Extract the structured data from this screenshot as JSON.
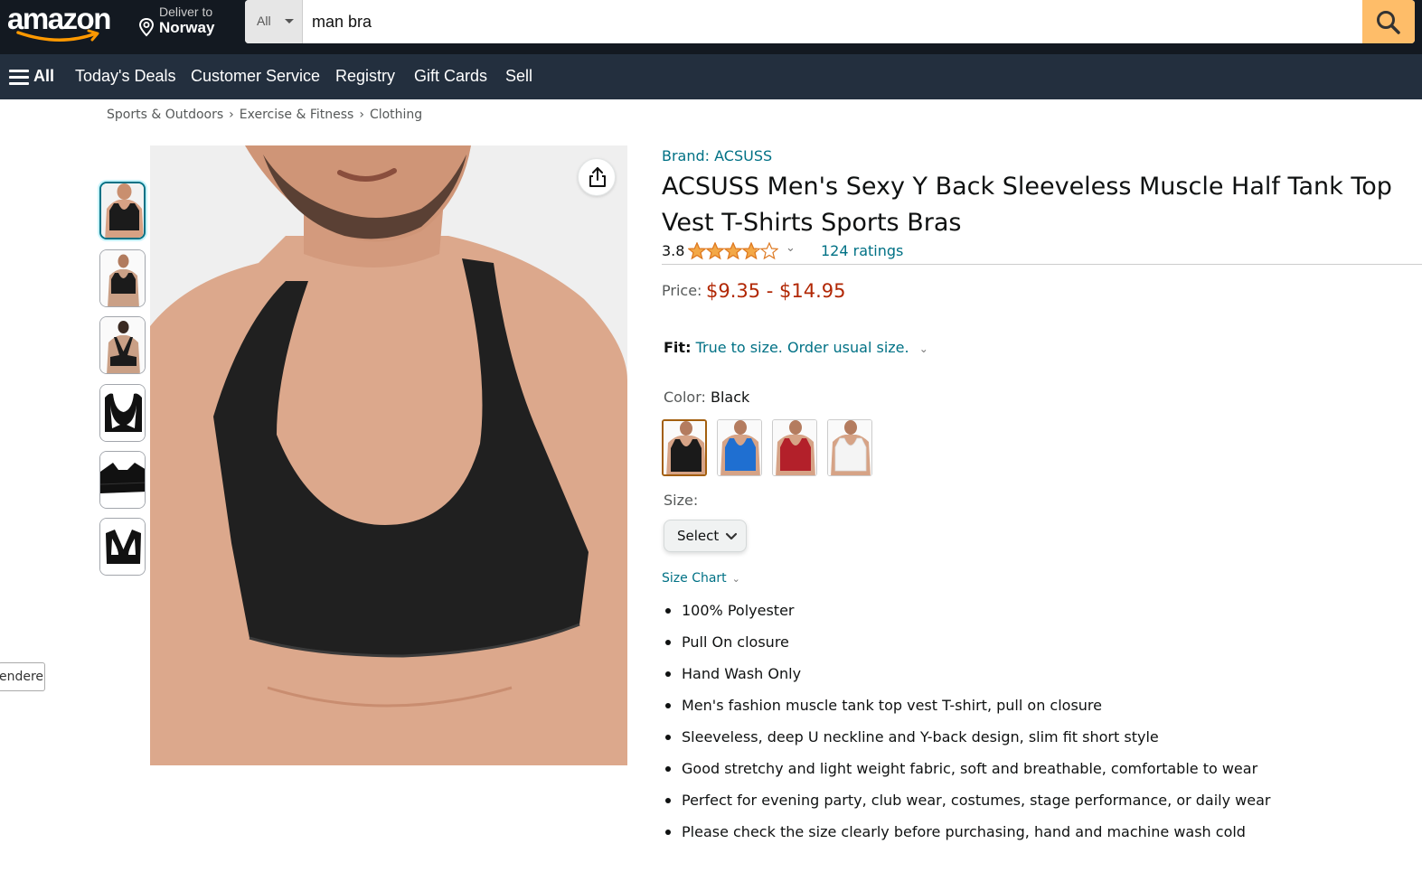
{
  "header": {
    "logo_text": "amazon",
    "deliver_to_label": "Deliver to",
    "deliver_to_location": "Norway",
    "search": {
      "category": "All",
      "query": "man bra"
    }
  },
  "nav": {
    "all_label": "All",
    "items": [
      "Today's Deals",
      "Customer Service",
      "Registry",
      "Gift Cards",
      "Sell"
    ]
  },
  "breadcrumb": [
    "Sports & Outdoors",
    "Exercise & Fitness",
    "Clothing"
  ],
  "breadcrumb_separator": "›",
  "side_tooltip": "endere",
  "product": {
    "brand": "Brand: ACSUSS",
    "title": "ACSUSS Men's Sexy Y Back Sleeveless Muscle Half Tank Top Vest T-Shirts Sports Bras",
    "rating_value": "3.8",
    "rating_stars": 3.8,
    "ratings_count": "124 ratings",
    "price_label": "Price:",
    "price_value": "$9.35 - $14.95",
    "fit_label": "Fit:",
    "fit_value": "True to size. Order usual size.",
    "color_label": "Color:",
    "color_value": "Black",
    "swatches": [
      {
        "name": "black",
        "color": "#1a1a1a"
      },
      {
        "name": "blue",
        "color": "#1f6fd1"
      },
      {
        "name": "red",
        "color": "#b3202a"
      },
      {
        "name": "white",
        "color": "#f4f4f4"
      }
    ],
    "size_label": "Size:",
    "size_select": "Select",
    "size_chart": "Size Chart",
    "features": [
      "100% Polyester",
      "Pull On closure",
      "Hand Wash Only",
      "Men's fashion muscle tank top vest T-shirt, pull on closure",
      "Sleeveless, deep U neckline and Y-back design, slim fit short style",
      "Good stretchy and light weight fabric, soft and breathable, comfortable to wear",
      "Perfect for evening party, club wear, costumes, stage performance, or daily wear",
      "Please check the size clearly before purchasing, hand and machine wash cold"
    ]
  },
  "colors": {
    "header_bg": "#131921",
    "nav_bg": "#232f3e",
    "search_button": "#febd69",
    "link": "#007185",
    "price": "#b12704",
    "star": "#f3a847"
  }
}
